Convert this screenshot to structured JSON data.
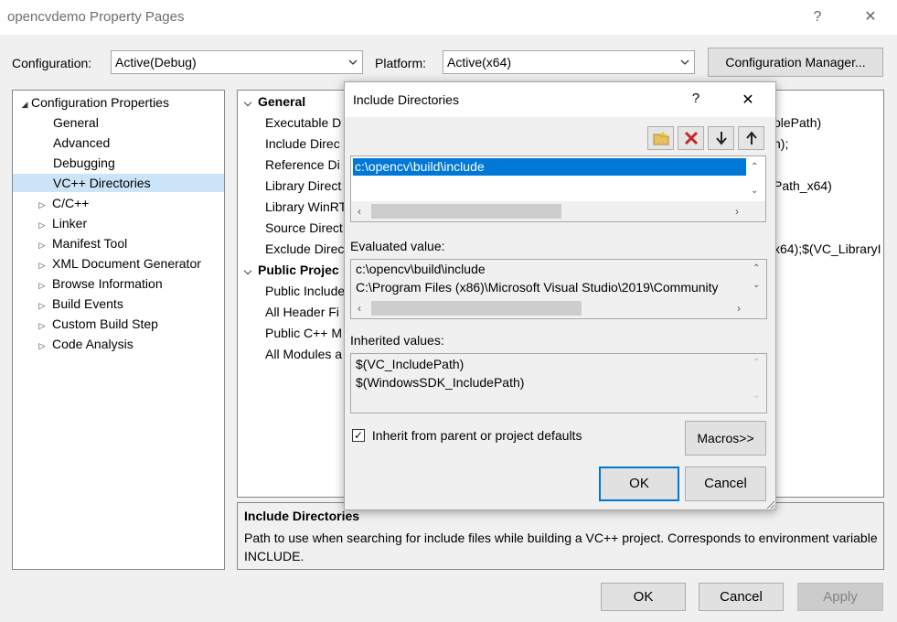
{
  "window": {
    "title": "opencvdemo Property Pages",
    "help_glyph": "?",
    "close_glyph": "✕"
  },
  "toolbar": {
    "configuration_label": "Configuration:",
    "configuration_value": "Active(Debug)",
    "platform_label": "Platform:",
    "platform_value": "Active(x64)",
    "config_manager_label": "Configuration Manager..."
  },
  "tree": {
    "root": "Configuration Properties",
    "items": [
      {
        "label": "General",
        "expandable": false,
        "selected": false
      },
      {
        "label": "Advanced",
        "expandable": false,
        "selected": false
      },
      {
        "label": "Debugging",
        "expandable": false,
        "selected": false
      },
      {
        "label": "VC++ Directories",
        "expandable": false,
        "selected": true
      },
      {
        "label": "C/C++",
        "expandable": true,
        "selected": false
      },
      {
        "label": "Linker",
        "expandable": true,
        "selected": false
      },
      {
        "label": "Manifest Tool",
        "expandable": true,
        "selected": false
      },
      {
        "label": "XML Document Generator",
        "expandable": true,
        "selected": false
      },
      {
        "label": "Browse Information",
        "expandable": true,
        "selected": false
      },
      {
        "label": "Build Events",
        "expandable": true,
        "selected": false
      },
      {
        "label": "Custom Build Step",
        "expandable": true,
        "selected": false
      },
      {
        "label": "Code Analysis",
        "expandable": true,
        "selected": false
      }
    ]
  },
  "grid": {
    "general_category": "General",
    "rows": [
      {
        "name": "Executable D",
        "value": "blePath)"
      },
      {
        "name": "Include Direc",
        "value": "n);"
      },
      {
        "name": "Reference Di",
        "value": ""
      },
      {
        "name": "Library Direct",
        "value": "Path_x64)"
      },
      {
        "name": "Library WinRT",
        "value": ""
      },
      {
        "name": "Source Direct",
        "value": ""
      },
      {
        "name": "Exclude Direc",
        "value": "x64);$(VC_LibraryI"
      }
    ],
    "public_category": "Public Projec",
    "public_rows": [
      {
        "name": "Public Include"
      },
      {
        "name": "All Header Fi"
      },
      {
        "name": "Public C++ M"
      },
      {
        "name": "All Modules a"
      }
    ]
  },
  "description": {
    "title": "Include Directories",
    "text": "Path to use when searching for include files while building a VC++ project.  Corresponds to environment variable INCLUDE."
  },
  "footer": {
    "ok_label": "OK",
    "cancel_label": "Cancel",
    "apply_label": "Apply"
  },
  "dialog": {
    "title": "Include Directories",
    "help_glyph": "?",
    "close_glyph": "✕",
    "tool_icons": [
      "new-folder-icon",
      "delete-icon",
      "move-down-icon",
      "move-up-icon"
    ],
    "list_items": [
      "c:\\opencv\\build\\include"
    ],
    "evaluated_label": "Evaluated value:",
    "evaluated_lines": [
      "c:\\opencv\\build\\include",
      "C:\\Program Files (x86)\\Microsoft Visual Studio\\2019\\Community"
    ],
    "inherited_label": "Inherited values:",
    "inherited_lines": [
      "$(VC_IncludePath)",
      "$(WindowsSDK_IncludePath)"
    ],
    "inherit_checkbox_label": "Inherit from parent or project defaults",
    "inherit_checked": true,
    "checkmark": "✓",
    "macros_label": "Macros>>",
    "ok_label": "OK",
    "cancel_label": "Cancel"
  }
}
